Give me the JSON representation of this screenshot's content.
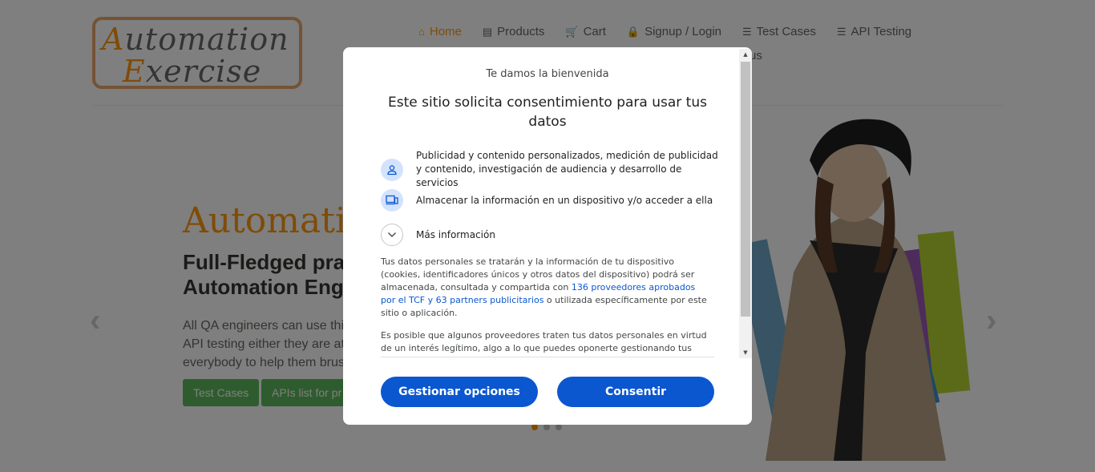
{
  "site": {
    "logo": {
      "line1_cap": "A",
      "line1_rest": "utomation",
      "line2_cap": "E",
      "line2_rest": "xercise"
    },
    "nav": [
      {
        "icon": "home-icon",
        "glyph": "⌂",
        "label": "Home"
      },
      {
        "icon": "products-icon",
        "glyph": "▤",
        "label": "Products"
      },
      {
        "icon": "cart-icon",
        "glyph": "🛒",
        "label": "Cart"
      },
      {
        "icon": "lock-icon",
        "glyph": "🔒",
        "label": "Signup / Login"
      },
      {
        "icon": "list-icon",
        "glyph": "☰",
        "label": "Test Cases"
      },
      {
        "icon": "list-icon",
        "glyph": "☰",
        "label": "API Testing"
      }
    ],
    "nav_overflow": "us",
    "hero": {
      "title": "Automatic",
      "subtitle_line1": "Full-Fledged pra",
      "subtitle_line2": "Automation Eng",
      "desc_line1": "All QA engineers can use thi",
      "desc_line2": "API testing either they are at",
      "desc_line3": "everybody to help them brus",
      "btn_test_cases": "Test Cases",
      "btn_apis": "APIs list for pr"
    },
    "arrows": {
      "left": "‹",
      "right": "›"
    },
    "carousel_dots": 3,
    "active_dot": 0,
    "colors": {
      "accent": "#fe980f",
      "button": "#5cb85c"
    }
  },
  "consent": {
    "welcome": "Te damos la bienvenida",
    "headline": "Este sitio solicita consentimiento para usar tus datos",
    "purposes": [
      {
        "icon": "person-icon",
        "text": "Publicidad y contenido personalizados, medición de publicidad y contenido, investigación de audiencia y desarrollo de servicios"
      },
      {
        "icon": "device-icon",
        "text": "Almacenar la información en un dispositivo y/o acceder a ella"
      }
    ],
    "more_info": "Más información",
    "legal_part1": "Tus datos personales se tratarán y la información de tu dispositivo (cookies, identificadores únicos y otros datos del dispositivo) podrá ser almacenada, consultada y compartida con ",
    "legal_link": "136 proveedores aprobados por el TCF y 63 partners publicitarios",
    "legal_part2": " o utilizada específicamente por este sitio o aplicación.",
    "legal_second": "Es posible que algunos proveedores traten tus datos personales en virtud de un interés legítimo, algo a lo que puedes oponerte gestionando tus",
    "btn_manage": "Gestionar opciones",
    "btn_consent": "Consentir",
    "colors": {
      "primary": "#0b57d0",
      "icon_bg": "#d3e3fd"
    }
  }
}
